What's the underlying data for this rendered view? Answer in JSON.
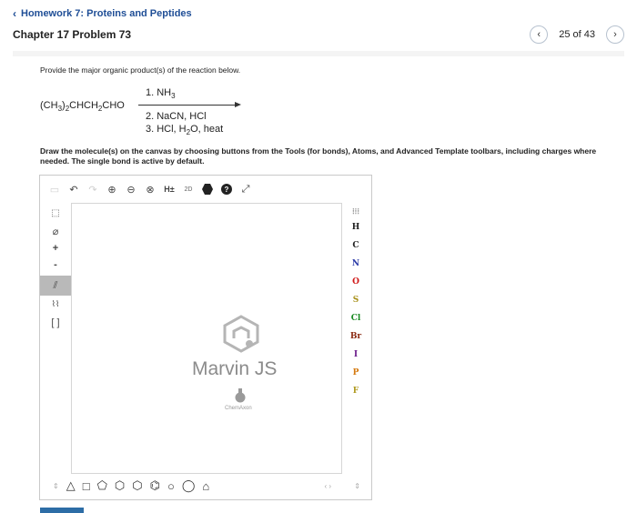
{
  "header": {
    "back_label": "Homework 7: Proteins and Peptides",
    "problem_title": "Chapter 17 Problem 73",
    "pager_count": "25 of 43"
  },
  "question": {
    "prompt": "Provide the major organic product(s) of the reaction below.",
    "reactant": "(CH3)2CHCH2CHO",
    "reagent_1": "1. NH3",
    "reagent_2": "2. NaCN, HCl",
    "reagent_3": "3. HCl, H2O, heat",
    "instructions": "Draw the molecule(s) on the canvas by choosing buttons from the Tools (for bonds), Atoms, and Advanced Template toolbars, including charges where needed. The single bond is active by default."
  },
  "editor": {
    "logo_text": "Marvin JS",
    "logo_sub": "ChemAxon",
    "atoms": [
      {
        "symbol": "H",
        "color": "#222222"
      },
      {
        "symbol": "C",
        "color": "#222222"
      },
      {
        "symbol": "N",
        "color": "#2b3aa8"
      },
      {
        "symbol": "O",
        "color": "#d01818"
      },
      {
        "symbol": "S",
        "color": "#a8901a"
      },
      {
        "symbol": "Cl",
        "color": "#1a8a22"
      },
      {
        "symbol": "Br",
        "color": "#8b2a12"
      },
      {
        "symbol": "I",
        "color": "#6a1a8a"
      },
      {
        "symbol": "P",
        "color": "#d57a10"
      },
      {
        "symbol": "F",
        "color": "#b09a20"
      }
    ],
    "top_tools": {
      "hydrogens_label": "H±",
      "dimension_label": "2D"
    },
    "left_tools": {
      "plus_label": "+",
      "minus_label": "-"
    }
  }
}
